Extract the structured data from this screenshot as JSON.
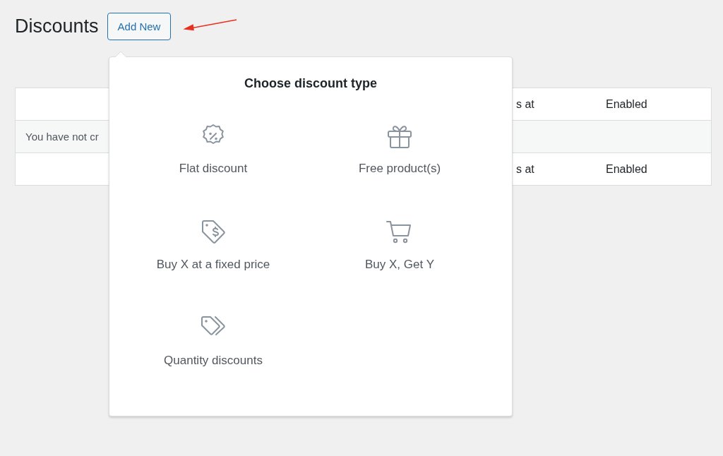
{
  "page_title": "Discounts",
  "add_button": "Add New",
  "table": {
    "header": [
      "s at",
      "Enabled"
    ],
    "message": "You have not cr",
    "footer": [
      "s at",
      "Enabled"
    ]
  },
  "popover": {
    "title": "Choose discount type",
    "options": [
      {
        "kind": "percent",
        "label": "Flat discount"
      },
      {
        "kind": "gift",
        "label": "Free product(s)"
      },
      {
        "kind": "price_tag",
        "label": "Buy X at a fixed price"
      },
      {
        "kind": "cart",
        "label": "Buy X, Get Y"
      },
      {
        "kind": "tags",
        "label": "Quantity discounts"
      }
    ]
  }
}
